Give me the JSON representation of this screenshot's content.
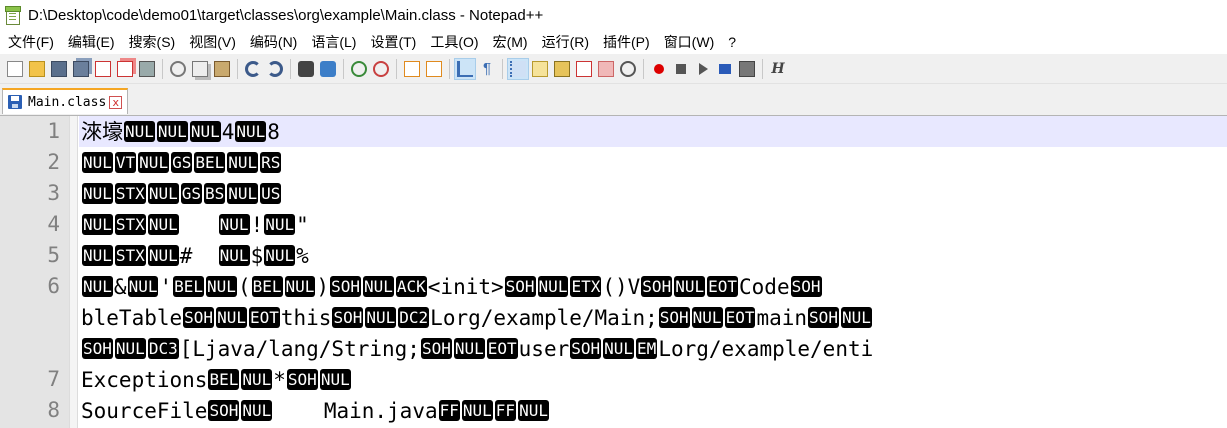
{
  "window": {
    "title": "D:\\Desktop\\code\\demo01\\target\\classes\\org\\example\\Main.class - Notepad++"
  },
  "menu": [
    {
      "label": "文件(F)"
    },
    {
      "label": "编辑(E)"
    },
    {
      "label": "搜索(S)"
    },
    {
      "label": "视图(V)"
    },
    {
      "label": "编码(N)"
    },
    {
      "label": "语言(L)"
    },
    {
      "label": "设置(T)"
    },
    {
      "label": "工具(O)"
    },
    {
      "label": "宏(M)"
    },
    {
      "label": "运行(R)"
    },
    {
      "label": "插件(P)"
    },
    {
      "label": "窗口(W)"
    },
    {
      "label": "?"
    }
  ],
  "toolbar_icons": [
    "new-file-icon",
    "open-file-icon",
    "save-icon",
    "save-all-icon",
    "close-icon",
    "close-all-icon",
    "print-icon",
    "sep",
    "cut-icon",
    "copy-icon",
    "paste-icon",
    "sep",
    "undo-icon",
    "redo-icon",
    "sep",
    "find-icon",
    "replace-icon",
    "sep",
    "zoom-in-icon",
    "zoom-out-icon",
    "sep",
    "sync-vertical-icon",
    "sync-horizontal-icon",
    "sep",
    "word-wrap-icon",
    "show-all-chars-icon",
    "sep",
    "indent-guide-icon",
    "document-map-icon",
    "function-list-icon",
    "folder-as-workspace-icon",
    "document-list-icon",
    "monitoring-icon",
    "sep",
    "macro-record-icon",
    "macro-stop-icon",
    "macro-play-icon",
    "macro-run-multiple-icon",
    "macro-save-icon",
    "sep",
    "spell-check-icon"
  ],
  "tabs": [
    {
      "label": "Main.class",
      "close": "x"
    }
  ],
  "editor": {
    "lines": [
      {
        "num": "1",
        "segments": [
          {
            "t": "淶壕"
          },
          {
            "c": "NUL"
          },
          {
            "c": "NUL"
          },
          {
            "c": "NUL"
          },
          {
            "t": "4"
          },
          {
            "c": "NUL"
          },
          {
            "t": "8"
          }
        ]
      },
      {
        "num": "2",
        "segments": [
          {
            "c": "NUL"
          },
          {
            "c": "VT"
          },
          {
            "c": "NUL"
          },
          {
            "c": "GS"
          },
          {
            "c": "BEL"
          },
          {
            "c": "NUL"
          },
          {
            "c": "RS"
          }
        ]
      },
      {
        "num": "3",
        "segments": [
          {
            "c": "NUL"
          },
          {
            "c": "STX"
          },
          {
            "c": "NUL"
          },
          {
            "c": "GS"
          },
          {
            "c": "BS"
          },
          {
            "c": "NUL"
          },
          {
            "c": "US"
          }
        ]
      },
      {
        "num": "4",
        "segments": [
          {
            "c": "NUL"
          },
          {
            "c": "STX"
          },
          {
            "c": "NUL"
          },
          {
            "t": "   "
          },
          {
            "c": "NUL"
          },
          {
            "t": "!"
          },
          {
            "c": "NUL"
          },
          {
            "t": "\""
          }
        ]
      },
      {
        "num": "5",
        "segments": [
          {
            "c": "NUL"
          },
          {
            "c": "STX"
          },
          {
            "c": "NUL"
          },
          {
            "t": "#  "
          },
          {
            "c": "NUL"
          },
          {
            "t": "$"
          },
          {
            "c": "NUL"
          },
          {
            "t": "%"
          }
        ]
      },
      {
        "num": "6",
        "segments": [
          {
            "c": "NUL"
          },
          {
            "t": "&"
          },
          {
            "c": "NUL"
          },
          {
            "t": "'"
          },
          {
            "c": "BEL"
          },
          {
            "c": "NUL"
          },
          {
            "t": "("
          },
          {
            "c": "BEL"
          },
          {
            "c": "NUL"
          },
          {
            "t": ")"
          },
          {
            "c": "SOH"
          },
          {
            "c": "NUL"
          },
          {
            "c": "ACK"
          },
          {
            "t": "<init>"
          },
          {
            "c": "SOH"
          },
          {
            "c": "NUL"
          },
          {
            "c": "ETX"
          },
          {
            "t": "()V"
          },
          {
            "c": "SOH"
          },
          {
            "c": "NUL"
          },
          {
            "c": "EOT"
          },
          {
            "t": "Code"
          },
          {
            "c": "SOH"
          }
        ]
      },
      {
        "num": "",
        "segments": [
          {
            "t": "bleTable"
          },
          {
            "c": "SOH"
          },
          {
            "c": "NUL"
          },
          {
            "c": "EOT"
          },
          {
            "t": "this"
          },
          {
            "c": "SOH"
          },
          {
            "c": "NUL"
          },
          {
            "c": "DC2"
          },
          {
            "t": "Lorg/example/Main;"
          },
          {
            "c": "SOH"
          },
          {
            "c": "NUL"
          },
          {
            "c": "EOT"
          },
          {
            "t": "main"
          },
          {
            "c": "SOH"
          },
          {
            "c": "NUL"
          }
        ]
      },
      {
        "num": "",
        "segments": [
          {
            "c": "SOH"
          },
          {
            "c": "NUL"
          },
          {
            "c": "DC3"
          },
          {
            "t": "[Ljava/lang/String;"
          },
          {
            "c": "SOH"
          },
          {
            "c": "NUL"
          },
          {
            "c": "EOT"
          },
          {
            "t": "user"
          },
          {
            "c": "SOH"
          },
          {
            "c": "NUL"
          },
          {
            "c": "EM"
          },
          {
            "t": "Lorg/example/enti"
          }
        ]
      },
      {
        "num": "7",
        "segments": [
          {
            "t": "Exceptions"
          },
          {
            "c": "BEL"
          },
          {
            "c": "NUL"
          },
          {
            "t": "*"
          },
          {
            "c": "SOH"
          },
          {
            "c": "NUL"
          }
        ]
      },
      {
        "num": "8",
        "segments": [
          {
            "t": "SourceFile"
          },
          {
            "c": "SOH"
          },
          {
            "c": "NUL"
          },
          {
            "t": "    Main.java"
          },
          {
            "c": "FF"
          },
          {
            "c": "NUL"
          },
          {
            "c": "FF"
          },
          {
            "c": "NUL"
          }
        ]
      }
    ]
  }
}
